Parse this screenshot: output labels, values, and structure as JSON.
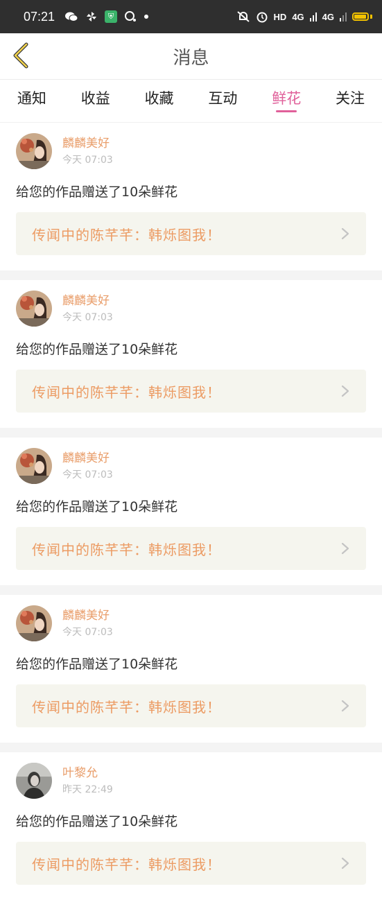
{
  "status_bar": {
    "time": "07:21",
    "left_icons": [
      "wechat-icon",
      "pinwheel-icon",
      "shield-icon",
      "chat-icon",
      "dot-icon"
    ],
    "right_text": "HD",
    "signal1": "4G",
    "signal2": "4G",
    "colors": {
      "battery": "#f2c200",
      "shield": "#3bb36a"
    }
  },
  "header": {
    "title": "消息"
  },
  "tabs": [
    {
      "label": "通知"
    },
    {
      "label": "收益"
    },
    {
      "label": "收藏"
    },
    {
      "label": "互动"
    },
    {
      "label": "鲜花",
      "active": true
    },
    {
      "label": "关注"
    }
  ],
  "messages": [
    {
      "user": "麟麟美好",
      "time": "今天 07:03",
      "text": "给您的作品赠送了10朵鲜花",
      "work": "传闻中的陈芊芊：韩烁图我！"
    },
    {
      "user": "麟麟美好",
      "time": "今天 07:03",
      "text": "给您的作品赠送了10朵鲜花",
      "work": "传闻中的陈芊芊：韩烁图我！"
    },
    {
      "user": "麟麟美好",
      "time": "今天 07:03",
      "text": "给您的作品赠送了10朵鲜花",
      "work": "传闻中的陈芊芊：韩烁图我！"
    },
    {
      "user": "麟麟美好",
      "time": "今天 07:03",
      "text": "给您的作品赠送了10朵鲜花",
      "work": "传闻中的陈芊芊：韩烁图我！"
    },
    {
      "user": "叶黎允",
      "time": "昨天 22:49",
      "text": "给您的作品赠送了10朵鲜花",
      "work": "传闻中的陈芊芊：韩烁图我！"
    }
  ],
  "colors": {
    "accent": "#e0609a",
    "username": "#e99e6b",
    "work_title": "#ec9b63",
    "work_bg": "#f5f5ee"
  }
}
